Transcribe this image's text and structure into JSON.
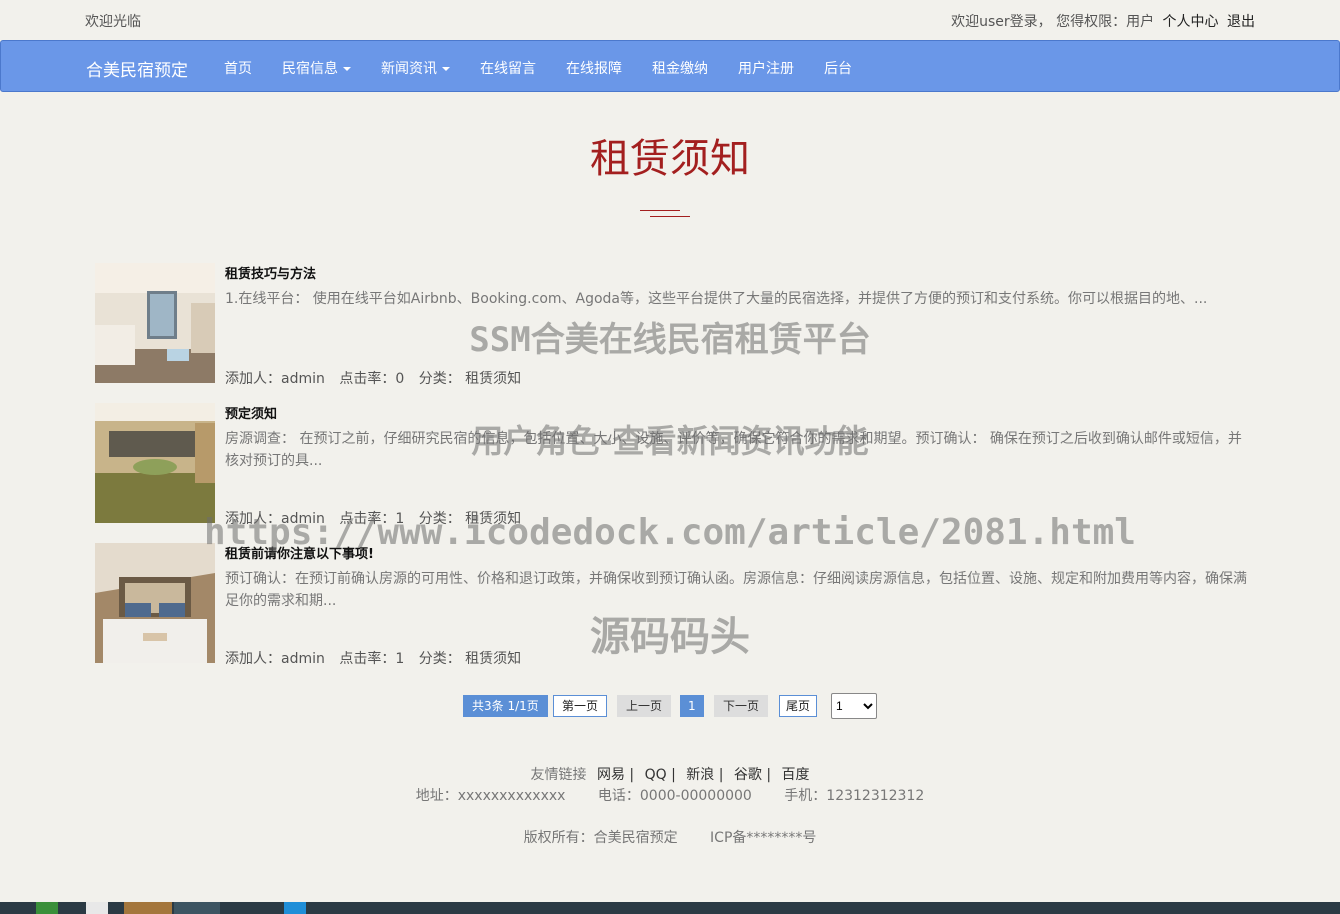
{
  "topbar": {
    "welcome": "欢迎光临",
    "login_info": "欢迎user登录，  您得权限：用户",
    "profile_link": "个人中心",
    "logout_link": "退出"
  },
  "navbar": {
    "brand": "合美民宿预定",
    "items": [
      {
        "label": "首页"
      },
      {
        "label": "民宿信息"
      },
      {
        "label": "新闻资讯"
      },
      {
        "label": "在线留言"
      },
      {
        "label": "在线报障"
      },
      {
        "label": "租金缴纳"
      },
      {
        "label": "用户注册"
      },
      {
        "label": "后台"
      }
    ]
  },
  "page": {
    "title": "租赁须知"
  },
  "news": [
    {
      "title": "租赁技巧与方法",
      "summary": "1.在线平台： 使用在线平台如Airbnb、Booking.com、Agoda等，这些平台提供了大量的民宿选择，并提供了方便的预订和支付系统。你可以根据目的地、...",
      "author": "添加人：admin",
      "clicks": "点击率：0",
      "category": "分类：  租赁须知"
    },
    {
      "title": "预定须知",
      "summary": "房源调查： 在预订之前，仔细研究民宿的信息，包括位置、大小、设施、评价等，确保它符合你的需求和期望。预订确认： 确保在预订之后收到确认邮件或短信，并核对预订的具...",
      "author": "添加人：admin",
      "clicks": "点击率：1",
      "category": "分类：  租赁须知"
    },
    {
      "title": "租赁前请你注意以下事项!",
      "summary": "预订确认：在预订前确认房源的可用性、价格和退订政策，并确保收到预订确认函。房源信息：仔细阅读房源信息，包括位置、设施、规定和附加费用等内容，确保满足你的需求和期...",
      "author": "添加人：admin",
      "clicks": "点击率：1",
      "category": "分类：  租赁须知"
    }
  ],
  "pagination": {
    "info": "共3条   1/1页",
    "first": "第一页",
    "prev": "上一页",
    "current": "1",
    "next": "下一页",
    "last": "尾页",
    "select_value": "1"
  },
  "footer": {
    "links_label": "友情链接",
    "links": [
      "网易 |",
      "QQ |",
      "新浪 |",
      "谷歌 |",
      "百度"
    ],
    "address": "地址：xxxxxxxxxxxxx",
    "phone": "电话：0000-00000000",
    "mobile": "手机：12312312312",
    "copyright": "版权所有：合美民宿预定",
    "icp": "ICP备********号"
  },
  "watermark": {
    "line1": "SSM合美在线民宿租赁平台",
    "line2": "用户角色-查看新闻资讯功能",
    "line3": "https://www.icodedock.com/article/2081.html",
    "line4": "源码码头"
  },
  "colors": {
    "background": "#f2f1ec",
    "navbar": "#6a97e8",
    "title": "#a31f1f",
    "pager_accent": "#5b8fd6"
  }
}
